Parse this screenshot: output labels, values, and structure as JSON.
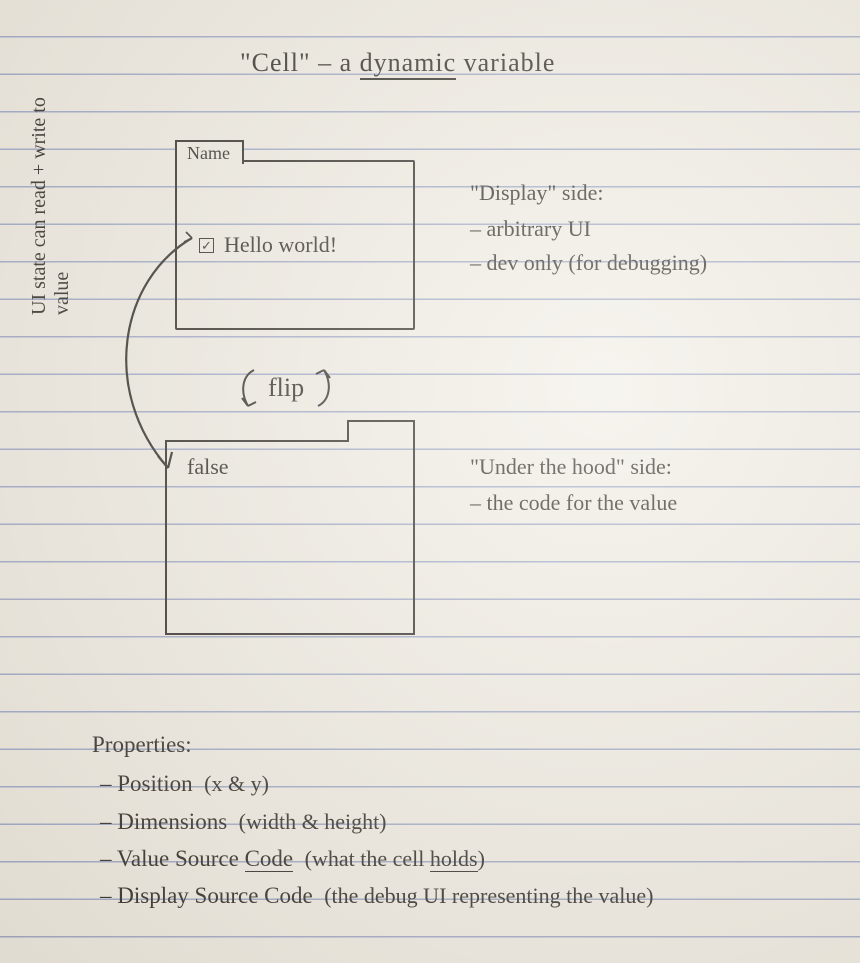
{
  "title": {
    "quoted": "\"Cell\"",
    "dash": "–",
    "article": "a",
    "emph": "dynamic",
    "rest": "variable"
  },
  "sideways_note": "UI state can read + write to value",
  "card_display": {
    "tab_label": "Name",
    "checkbox_checked": "✓",
    "content_text": "Hello world!"
  },
  "flip_label": "flip",
  "card_under": {
    "content_text": "false"
  },
  "display_side": {
    "heading": "\"Display\" side:",
    "items": [
      "arbitrary UI",
      "dev only  (for debugging)"
    ]
  },
  "under_hood_side": {
    "heading": "\"Under the hood\" side:",
    "items": [
      "the code for the value"
    ]
  },
  "properties": {
    "heading": "Properties:",
    "items": [
      {
        "name": "Position",
        "note": "(x & y)"
      },
      {
        "name": "Dimensions",
        "note": "(width & height)"
      },
      {
        "name": "Value Source",
        "underlined": "Code",
        "note": "(what the cell ",
        "note_underlined": "holds",
        "note_end": ")"
      },
      {
        "name": "Display Source Code",
        "note": "(the debug UI representing the value)"
      }
    ]
  }
}
